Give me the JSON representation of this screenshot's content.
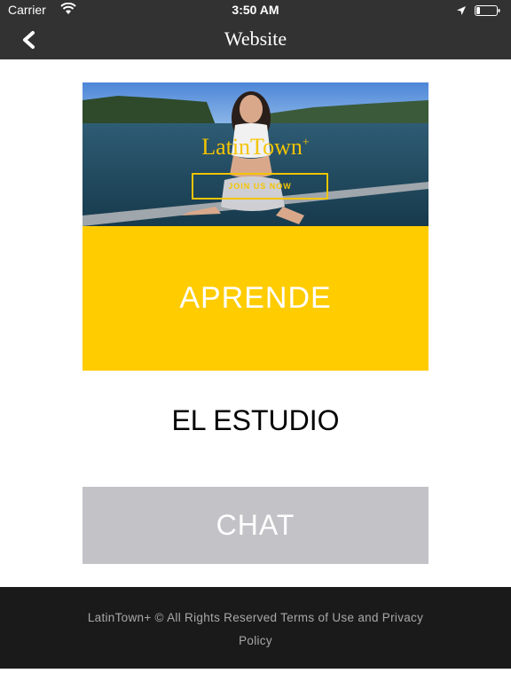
{
  "status_bar": {
    "carrier": "Carrier",
    "time": "3:50 AM",
    "icons": [
      "wifi-icon",
      "location-icon",
      "battery-icon"
    ]
  },
  "nav": {
    "title": "Website",
    "back_icon": "chevron-left-icon"
  },
  "banner": {
    "logo_text": "LatinTown",
    "logo_superscript": "+",
    "join_label": "JOIN US NOW"
  },
  "main": {
    "aprende_label": "APRENDE",
    "estudio_label": "EL ESTUDIO",
    "chat_label": "CHAT"
  },
  "footer": {
    "text": "LatinTown+ © All Rights Reserved Terms of Use and Privacy Policy"
  },
  "colors": {
    "bar_background": "#323232",
    "aprende_background": "#ffcc00",
    "chat_background": "#c3c2c7",
    "footer_background": "#1a1a1a",
    "logo_gold": "#f4c400"
  }
}
